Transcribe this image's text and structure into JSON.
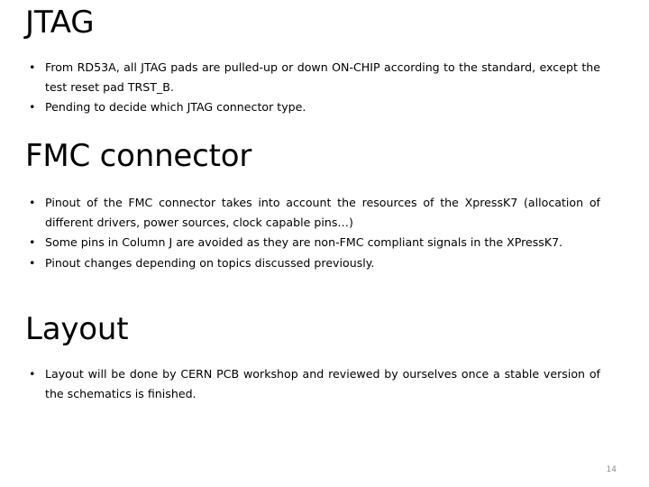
{
  "slide": {
    "page_number": "14",
    "background_color": "#ffffff",
    "text_color": "#000000",
    "page_number_color": "#8c8c8c",
    "bullet_glyph": "•"
  },
  "sections": [
    {
      "heading": "JTAG",
      "bullets": [
        "From RD53A, all JTAG pads are pulled-up or down ON-CHIP according to the standard, except the test reset pad TRST_B.",
        "Pending to decide which JTAG connector type."
      ]
    },
    {
      "heading": "FMC connector",
      "bullets": [
        "Pinout of the FMC connector takes into account the resources of the XpressK7 (allocation of different drivers, power sources, clock capable pins…)",
        "Some pins in Column J are avoided as they are non-FMC compliant signals in the XPressK7.",
        "Pinout changes depending on topics discussed previously."
      ]
    },
    {
      "heading": "Layout",
      "bullets": [
        "Layout will be done by CERN PCB workshop and reviewed by ourselves once a stable version of the schematics is finished."
      ]
    }
  ]
}
